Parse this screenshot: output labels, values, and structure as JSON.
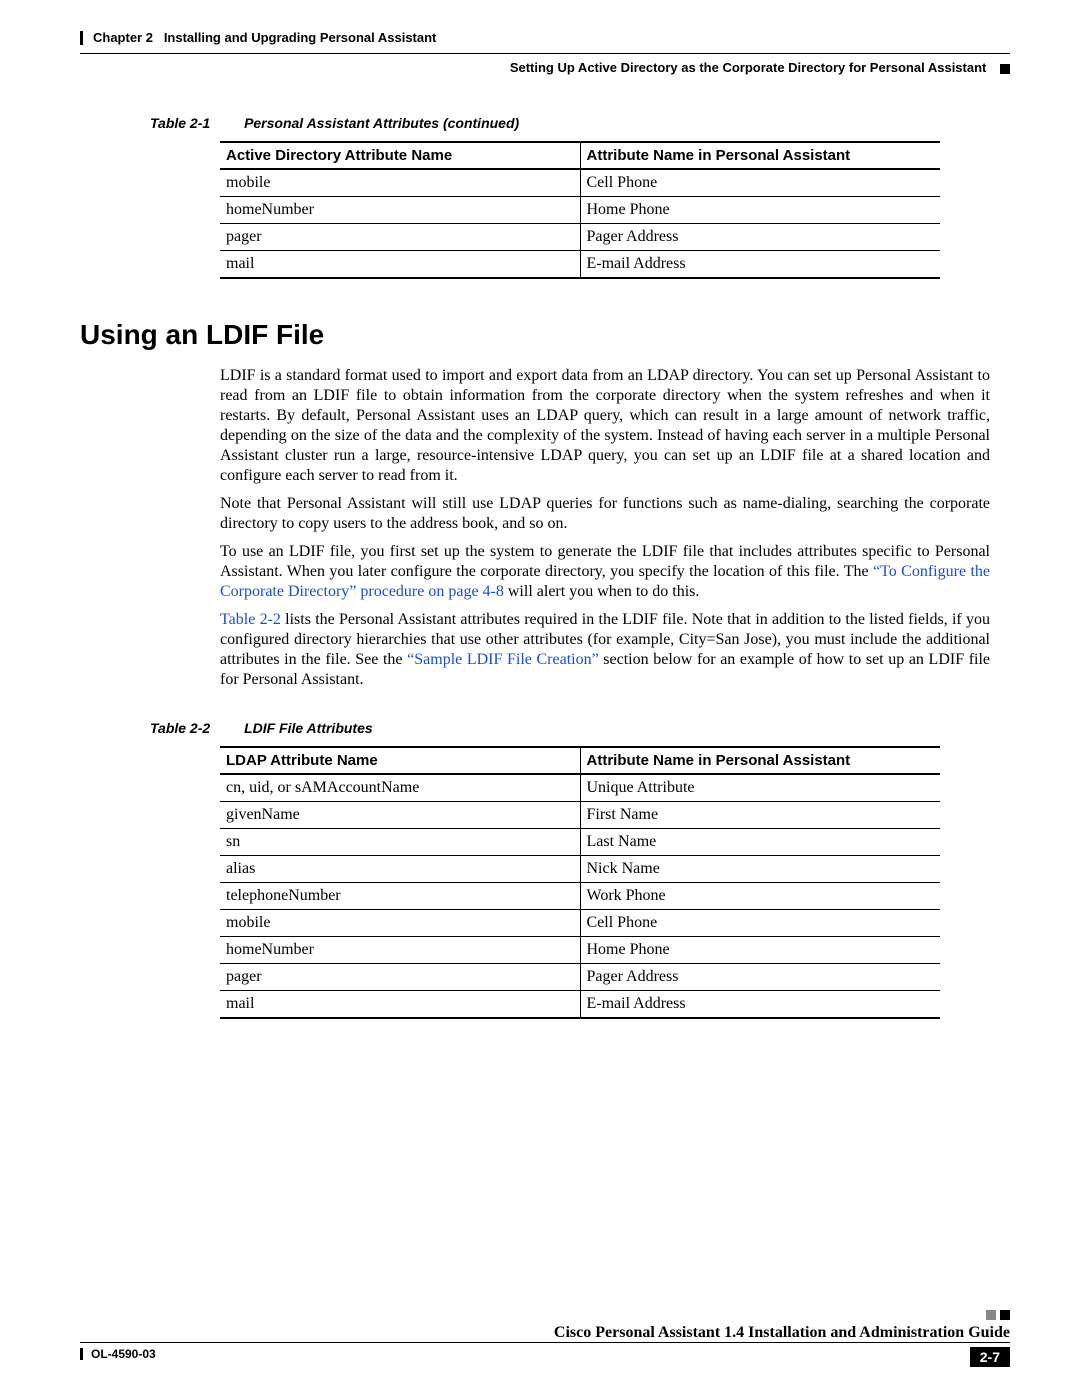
{
  "header": {
    "chapter": "Chapter 2",
    "chapter_title": "Installing and Upgrading Personal Assistant",
    "section_path": "Setting Up Active Directory as the Corporate Directory for Personal Assistant"
  },
  "table1": {
    "label": "Table 2-1",
    "title": "Personal Assistant Attributes (continued)",
    "col1_header": "Active Directory Attribute Name",
    "col2_header": "Attribute Name in Personal Assistant",
    "rows": [
      {
        "c1": "mobile",
        "c2": "Cell Phone"
      },
      {
        "c1": "homeNumber",
        "c2": "Home Phone"
      },
      {
        "c1": "pager",
        "c2": "Pager Address"
      },
      {
        "c1": "mail",
        "c2": "E-mail Address"
      }
    ]
  },
  "section_heading": "Using an LDIF File",
  "paragraphs": {
    "p1": "LDIF is a standard format used to import and export data from an LDAP directory. You can set up Personal Assistant to read from an LDIF file to obtain information from the corporate directory when the system refreshes and when it restarts. By default, Personal Assistant uses an LDAP query, which can result in a large amount of network traffic, depending on the size of the data and the complexity of the system. Instead of having each server in a multiple Personal Assistant cluster run a large, resource-intensive LDAP query, you can set up an LDIF file at a shared location and configure each server to read from it.",
    "p2": "Note that Personal Assistant will still use LDAP queries for functions such as name-dialing, searching the corporate directory to copy users to the address book, and so on.",
    "p3a": "To use an LDIF file, you first set up the system to generate the LDIF file that includes attributes specific to Personal Assistant. When you later configure the corporate directory, you specify the location of this file. The ",
    "p3_link": "“To Configure the Corporate Directory” procedure on page 4-8",
    "p3b": " will alert you when to do this.",
    "p4_link1": "Table 2-2",
    "p4a": " lists the Personal Assistant attributes required in the LDIF file. Note that in addition to the listed fields, if you configured directory hierarchies that use other attributes (for example, City=San Jose), you must include the additional attributes in the file. See the ",
    "p4_link2": "“Sample LDIF File Creation”",
    "p4b": " section below for an example of how to set up an LDIF file for Personal Assistant."
  },
  "table2": {
    "label": "Table 2-2",
    "title": "LDIF File Attributes",
    "col1_header": "LDAP Attribute Name",
    "col2_header": "Attribute Name in Personal Assistant",
    "rows": [
      {
        "c1": "cn, uid, or sAMAccountName",
        "c2": "Unique Attribute"
      },
      {
        "c1": "givenName",
        "c2": "First Name"
      },
      {
        "c1": "sn",
        "c2": "Last Name"
      },
      {
        "c1": "alias",
        "c2": "Nick Name"
      },
      {
        "c1": "telephoneNumber",
        "c2": "Work Phone"
      },
      {
        "c1": "mobile",
        "c2": "Cell Phone"
      },
      {
        "c1": "homeNumber",
        "c2": "Home Phone"
      },
      {
        "c1": "pager",
        "c2": "Pager Address"
      },
      {
        "c1": "mail",
        "c2": "E-mail Address"
      }
    ]
  },
  "footer": {
    "guide_title": "Cisco Personal Assistant 1.4 Installation and Administration Guide",
    "doc_id": "OL-4590-03",
    "page_num": "2-7"
  }
}
